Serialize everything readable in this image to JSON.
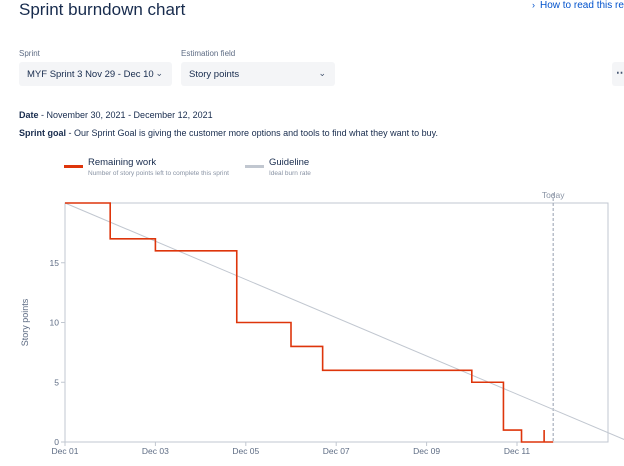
{
  "page": {
    "title": "Sprint burndown chart",
    "help_link": "How to read this repo"
  },
  "filters": {
    "sprint_label": "Sprint",
    "sprint_value": "MYF Sprint 3 Nov 29 - Dec 10",
    "estimation_label": "Estimation field",
    "estimation_value": "Story points"
  },
  "info": {
    "date_label": "Date",
    "date_value": " - November 30, 2021 - December 12, 2021",
    "goal_label": "Sprint goal",
    "goal_value": " - Our Sprint Goal is giving the customer more options and tools to find what they want to buy."
  },
  "legend": [
    {
      "title": "Remaining work",
      "subtitle": "Number of story points left to complete this sprint",
      "color": "#de350b"
    },
    {
      "title": "Guideline",
      "subtitle": "Ideal burn rate",
      "color": "#c1c7d0"
    }
  ],
  "chart_data": {
    "type": "line",
    "ylabel": "Story points",
    "xlabel": "",
    "y_ticks": [
      0,
      5,
      10,
      15
    ],
    "ylim": [
      0,
      20
    ],
    "x_ticks": [
      "Dec 01",
      "Dec 03",
      "Dec 05",
      "Dec 07",
      "Dec 09",
      "Dec 11"
    ],
    "x_range_days": [
      0,
      12.5
    ],
    "today_label": "Today",
    "today_day": 10.8,
    "series": [
      {
        "name": "Remaining work",
        "color": "#de350b",
        "step": true,
        "points": [
          {
            "day": 0,
            "y": 20
          },
          {
            "day": 1.0,
            "y": 20
          },
          {
            "day": 1.0,
            "y": 17
          },
          {
            "day": 2.0,
            "y": 17
          },
          {
            "day": 2.0,
            "y": 16
          },
          {
            "day": 3.8,
            "y": 16
          },
          {
            "day": 3.8,
            "y": 10
          },
          {
            "day": 5.0,
            "y": 10
          },
          {
            "day": 5.0,
            "y": 8
          },
          {
            "day": 5.7,
            "y": 8
          },
          {
            "day": 5.7,
            "y": 6
          },
          {
            "day": 9.0,
            "y": 6
          },
          {
            "day": 9.0,
            "y": 5
          },
          {
            "day": 9.7,
            "y": 5
          },
          {
            "day": 9.7,
            "y": 1
          },
          {
            "day": 10.1,
            "y": 1
          },
          {
            "day": 10.1,
            "y": 0
          },
          {
            "day": 10.6,
            "y": 0
          },
          {
            "day": 10.6,
            "y": 1
          },
          {
            "day": 10.6,
            "y": 0
          },
          {
            "day": 10.8,
            "y": 0
          }
        ]
      },
      {
        "name": "Guideline",
        "color": "#c1c7d0",
        "points": [
          {
            "day": 0,
            "y": 20
          },
          {
            "day": 12.5,
            "y": 0
          }
        ]
      }
    ],
    "grid": false,
    "colors": {
      "axis": "#c1c7d0",
      "today_line": "#97a0af",
      "text": "#5e6c84"
    }
  }
}
